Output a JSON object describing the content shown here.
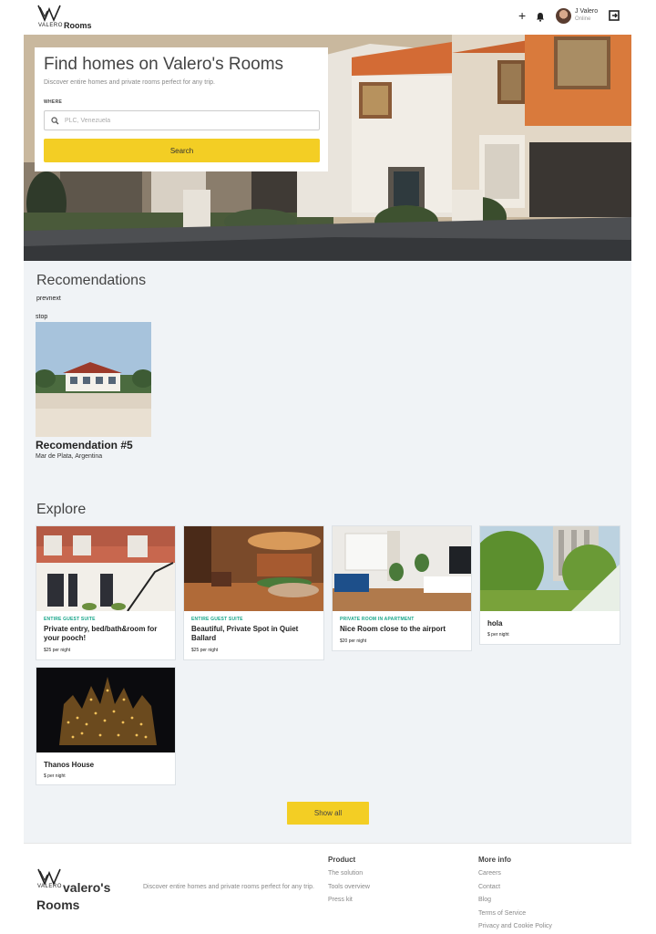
{
  "header": {
    "brand_small": "VALERO",
    "brand_rooms": "Rooms",
    "add_label": "+",
    "user": {
      "name": "J Valero",
      "status": "Online"
    }
  },
  "hero": {
    "title": "Find homes on Valero's Rooms",
    "subtitle": "Discover entire homes and private rooms perfect for any trip.",
    "where_label": "WHERE",
    "search_placeholder": "PLC, Venezuela",
    "search_button": "Search"
  },
  "recommendations": {
    "title": "Recomendations",
    "prev_label": "prev",
    "next_label": "next",
    "stop_label": "stop",
    "item": {
      "title": "Recomendation #5",
      "location": "Mar de Plata, Argentina"
    }
  },
  "explore": {
    "title": "Explore",
    "cards": [
      {
        "type": "ENTIRE GUEST SUITE",
        "name": "Private entry, bed/bath&room for your pooch!",
        "price": "$25 per night"
      },
      {
        "type": "ENTIRE GUEST SUITE",
        "name": "Beautiful, Private Spot in Quiet Ballard",
        "price": "$25 per night"
      },
      {
        "type": "PRIVATE ROOM IN APARTMENT",
        "name": "Nice Room close to the airport",
        "price": "$20 per night"
      },
      {
        "type": "",
        "name": "hola",
        "price": "$ per night"
      },
      {
        "type": "",
        "name": "Thanos House",
        "price": "$ per night"
      }
    ],
    "show_all": "Show all"
  },
  "footer": {
    "brand_small": "VALERO",
    "brand_line1": "valero's",
    "brand_line2": "Rooms",
    "description": "Discover entire homes and private rooms perfect for any trip.",
    "product": {
      "title": "Product",
      "links": [
        "The solution",
        "Tools overview",
        "Press kit"
      ]
    },
    "more": {
      "title": "More info",
      "links": [
        "Careers",
        "Contact",
        "Blog",
        "Terms of Service",
        "Privacy and Cookie Policy"
      ]
    }
  },
  "colors": {
    "accent": "#f3ce24",
    "type_label": "#17a589",
    "page_bg": "#f0f3f6"
  },
  "icons": [
    "logo-mark-icon",
    "plus-icon",
    "bell-icon",
    "avatar",
    "exit-icon",
    "search-icon"
  ]
}
